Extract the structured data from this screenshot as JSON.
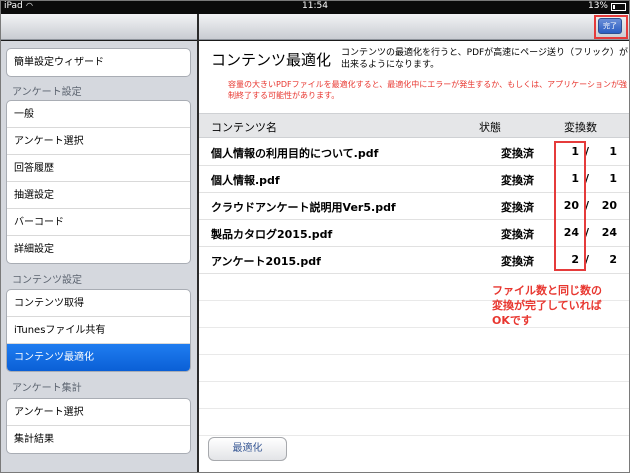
{
  "status_bar": {
    "carrier": "iPad",
    "time": "11:54",
    "battery": "13%"
  },
  "toolbar": {
    "done_label": "完了"
  },
  "sidebar": {
    "top_item": "簡単設定ウィザード",
    "sections": [
      {
        "header": "アンケート設定",
        "items": [
          "一般",
          "アンケート選択",
          "回答履歴",
          "抽選設定",
          "バーコード",
          "詳細設定"
        ]
      },
      {
        "header": "コンテンツ設定",
        "items": [
          "コンテンツ取得",
          "iTunesファイル共有",
          "コンテンツ最適化"
        ]
      },
      {
        "header": "アンケート集計",
        "items": [
          "アンケート選択",
          "集計結果"
        ]
      }
    ],
    "selected": "コンテンツ最適化"
  },
  "pane": {
    "title": "コンテンツ最適化",
    "description": "コンテンツの最適化を行うと、PDFが高速にページ送り（フリック）が出来るようになります。",
    "warning": "容量の大きいPDFファイルを最適化すると、最適化中にエラーが発生するか、もしくは、アプリケーションが強制終了する可能性があります。",
    "table": {
      "headers": [
        "コンテンツ名",
        "状態",
        "変換数"
      ],
      "rows": [
        {
          "name": "個人情報の利用目的について.pdf",
          "status": "変換済",
          "done": "1",
          "total": "1"
        },
        {
          "name": "個人情報.pdf",
          "status": "変換済",
          "done": "1",
          "total": "1"
        },
        {
          "name": "クラウドアンケート説明用Ver5.pdf",
          "status": "変換済",
          "done": "20",
          "total": "20"
        },
        {
          "name": "製品カタログ2015.pdf",
          "status": "変換済",
          "done": "24",
          "total": "24"
        },
        {
          "name": "アンケート2015.pdf",
          "status": "変換済",
          "done": "2",
          "total": "2"
        }
      ],
      "separator": "/"
    },
    "annotation": [
      "ファイル数と同じ数の",
      "変換が完了していれば",
      "OKです"
    ],
    "optimize_button": "最適化"
  }
}
